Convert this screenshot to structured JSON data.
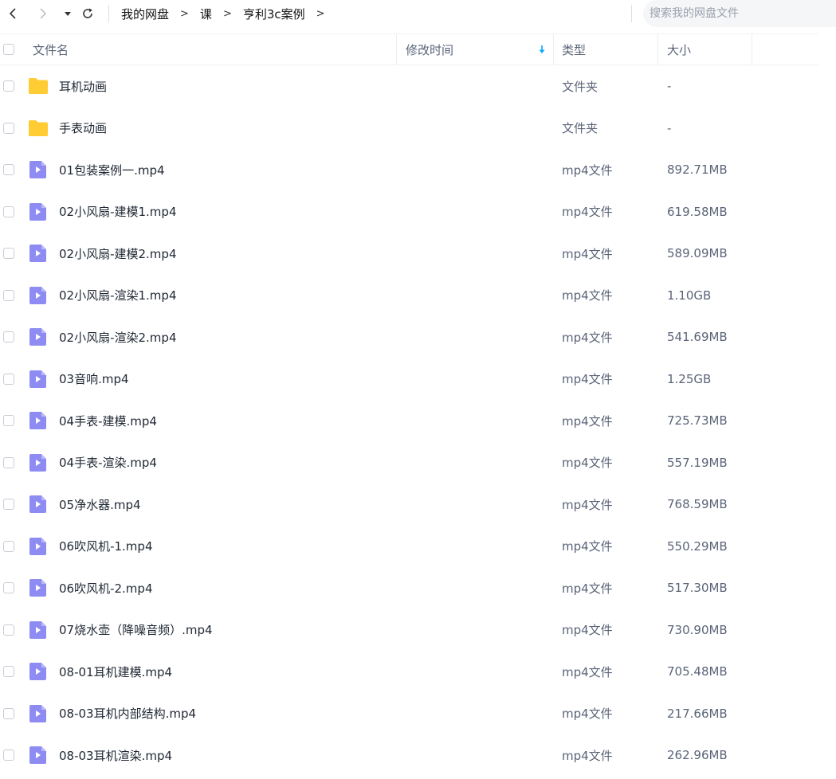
{
  "toolbar": {
    "back_icon": "chevron-left-icon",
    "forward_icon": "chevron-right-icon",
    "dropdown_icon": "caret-down-icon",
    "refresh_icon": "refresh-icon"
  },
  "breadcrumb": {
    "items": [
      "我的网盘",
      "课",
      "亨利3c案例"
    ],
    "separator": ">"
  },
  "search": {
    "placeholder": "搜索我的网盘文件"
  },
  "table": {
    "headers": {
      "name": "文件名",
      "modified": "修改时间",
      "type": "类型",
      "size": "大小"
    },
    "sort_icon": "arrow-down-icon",
    "sort_color": "#06a7ff",
    "rows": [
      {
        "name": "耳机动画",
        "type": "文件夹",
        "size": "-",
        "kind": "folder",
        "modified": ""
      },
      {
        "name": "手表动画",
        "type": "文件夹",
        "size": "-",
        "kind": "folder",
        "modified": ""
      },
      {
        "name": "01包装案例一.mp4",
        "type": "mp4文件",
        "size": "892.71MB",
        "kind": "video",
        "modified": ""
      },
      {
        "name": "02小风扇-建模1.mp4",
        "type": "mp4文件",
        "size": "619.58MB",
        "kind": "video",
        "modified": ""
      },
      {
        "name": "02小风扇-建模2.mp4",
        "type": "mp4文件",
        "size": "589.09MB",
        "kind": "video",
        "modified": ""
      },
      {
        "name": "02小风扇-渲染1.mp4",
        "type": "mp4文件",
        "size": "1.10GB",
        "kind": "video",
        "modified": ""
      },
      {
        "name": "02小风扇-渲染2.mp4",
        "type": "mp4文件",
        "size": "541.69MB",
        "kind": "video",
        "modified": ""
      },
      {
        "name": "03音响.mp4",
        "type": "mp4文件",
        "size": "1.25GB",
        "kind": "video",
        "modified": ""
      },
      {
        "name": "04手表-建模.mp4",
        "type": "mp4文件",
        "size": "725.73MB",
        "kind": "video",
        "modified": ""
      },
      {
        "name": "04手表-渲染.mp4",
        "type": "mp4文件",
        "size": "557.19MB",
        "kind": "video",
        "modified": ""
      },
      {
        "name": "05净水器.mp4",
        "type": "mp4文件",
        "size": "768.59MB",
        "kind": "video",
        "modified": ""
      },
      {
        "name": "06吹风机-1.mp4",
        "type": "mp4文件",
        "size": "550.29MB",
        "kind": "video",
        "modified": ""
      },
      {
        "name": "06吹风机-2.mp4",
        "type": "mp4文件",
        "size": "517.30MB",
        "kind": "video",
        "modified": ""
      },
      {
        "name": "07烧水壶（降噪音频）.mp4",
        "type": "mp4文件",
        "size": "730.90MB",
        "kind": "video",
        "modified": ""
      },
      {
        "name": "08-01耳机建模.mp4",
        "type": "mp4文件",
        "size": "705.48MB",
        "kind": "video",
        "modified": ""
      },
      {
        "name": "08-03耳机内部结构.mp4",
        "type": "mp4文件",
        "size": "217.66MB",
        "kind": "video",
        "modified": ""
      },
      {
        "name": "08-03耳机渲染.mp4",
        "type": "mp4文件",
        "size": "262.96MB",
        "kind": "video",
        "modified": ""
      }
    ]
  },
  "colors": {
    "folder": "#ffcc33",
    "video": "#8e8cf2",
    "video_play": "#ffffff"
  }
}
